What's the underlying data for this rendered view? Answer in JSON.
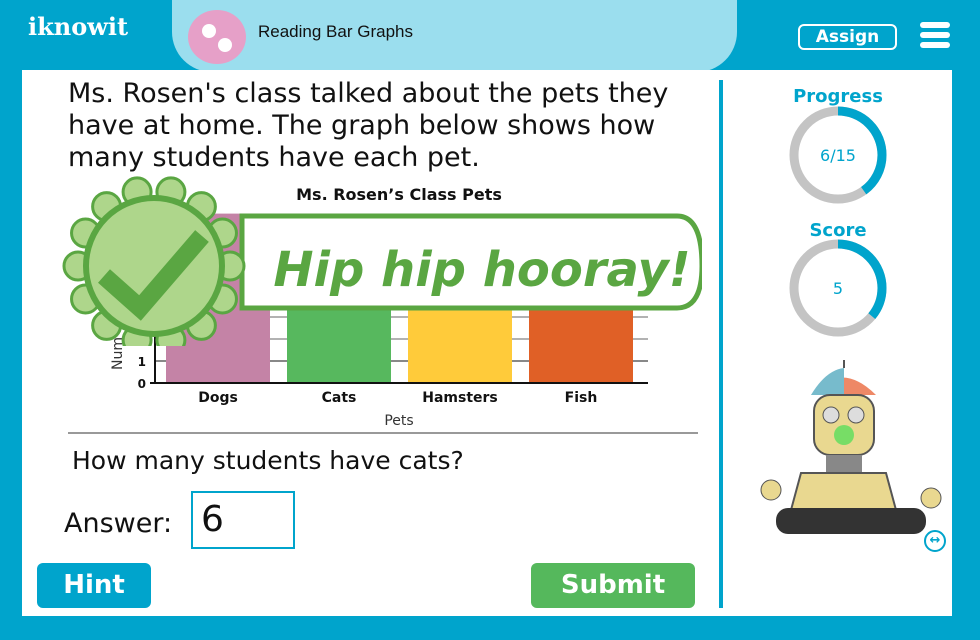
{
  "header": {
    "logo": "iknowit",
    "topic": "Reading Bar Graphs",
    "assign_label": "Assign",
    "menu_icon": "hamburger-icon"
  },
  "question": {
    "text": "Ms. Rosen's class talked about the pets they have at home. The graph below shows how many students have each pet.",
    "sub_question": "How many students have cats?",
    "answer_label": "Answer:",
    "answer_value": "6"
  },
  "feedback": {
    "text": "Hip hip hooray!",
    "icon": "checkmark-badge-icon",
    "color": "#5aa642"
  },
  "buttons": {
    "hint": "Hint",
    "submit": "Submit"
  },
  "sidebar": {
    "progress_label": "Progress",
    "progress_text": "6/15",
    "progress_fraction": 0.4,
    "score_label": "Score",
    "score_text": "5",
    "score_fraction": 0.36,
    "accent": "#00a4cc"
  },
  "chart_data": {
    "type": "bar",
    "title": "Ms. Rosen’s Class Pets",
    "xlabel": "Pets",
    "ylabel": "Num",
    "categories": [
      "Dogs",
      "Cats",
      "Hamsters",
      "Fish"
    ],
    "values": [
      null,
      6,
      null,
      null
    ],
    "colors": [
      "#c483a6",
      "#57b85e",
      "#ffcb3a",
      "#e06026"
    ],
    "yticks": [
      "0",
      "1"
    ],
    "grid": true
  }
}
